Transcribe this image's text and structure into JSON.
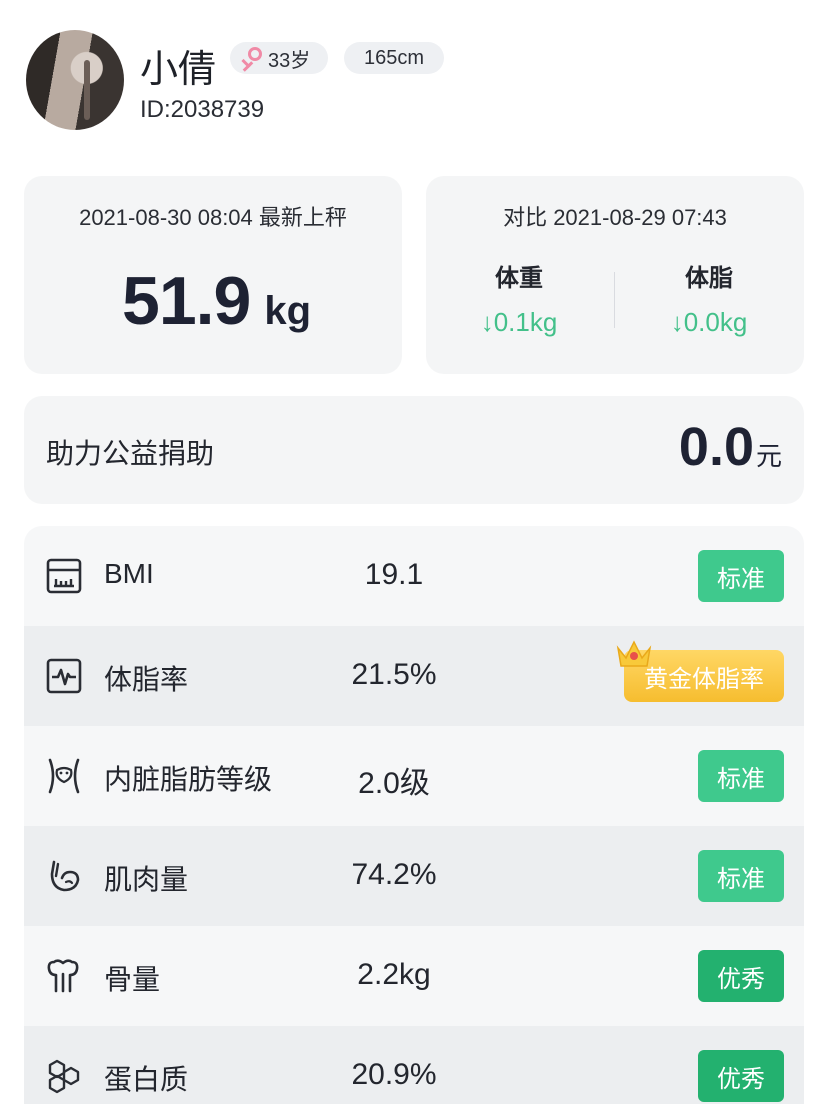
{
  "profile": {
    "name": "小倩",
    "age": "33岁",
    "height": "165cm",
    "id": "ID:2038739",
    "gender_icon": "female-icon"
  },
  "latest": {
    "time": "2021-08-30 08:04 最新上秤",
    "weight": "51.9",
    "unit": "kg"
  },
  "compare": {
    "title": "对比 2021-08-29 07:43",
    "weight_label": "体重",
    "weight_change": "↓0.1kg",
    "fat_label": "体脂",
    "fat_change": "↓0.0kg"
  },
  "donation": {
    "label": "助力公益捐助",
    "amount": "0.0",
    "unit": "元"
  },
  "metrics": [
    {
      "icon": "ruler-icon",
      "name": "BMI",
      "value": "19.1",
      "badge": "标准",
      "badge_type": "standard"
    },
    {
      "icon": "heart-rate-icon",
      "name": "体脂率",
      "value": "21.5%",
      "badge": "黄金体脂率",
      "badge_type": "gold"
    },
    {
      "icon": "visceral-icon",
      "name": "内脏脂肪等级",
      "value": "2.0级",
      "badge": "标准",
      "badge_type": "standard"
    },
    {
      "icon": "muscle-icon",
      "name": "肌肉量",
      "value": "74.2%",
      "badge": "标准",
      "badge_type": "standard"
    },
    {
      "icon": "bone-icon",
      "name": "骨量",
      "value": "2.2kg",
      "badge": "优秀",
      "badge_type": "excellent"
    },
    {
      "icon": "protein-icon",
      "name": "蛋白质",
      "value": "20.9%",
      "badge": "优秀",
      "badge_type": "excellent"
    }
  ],
  "colors": {
    "accent_green": "#3fc98d",
    "excellent_green": "#23b16f",
    "decrease_green": "#43c08a",
    "gold": "#f6bd2f"
  }
}
